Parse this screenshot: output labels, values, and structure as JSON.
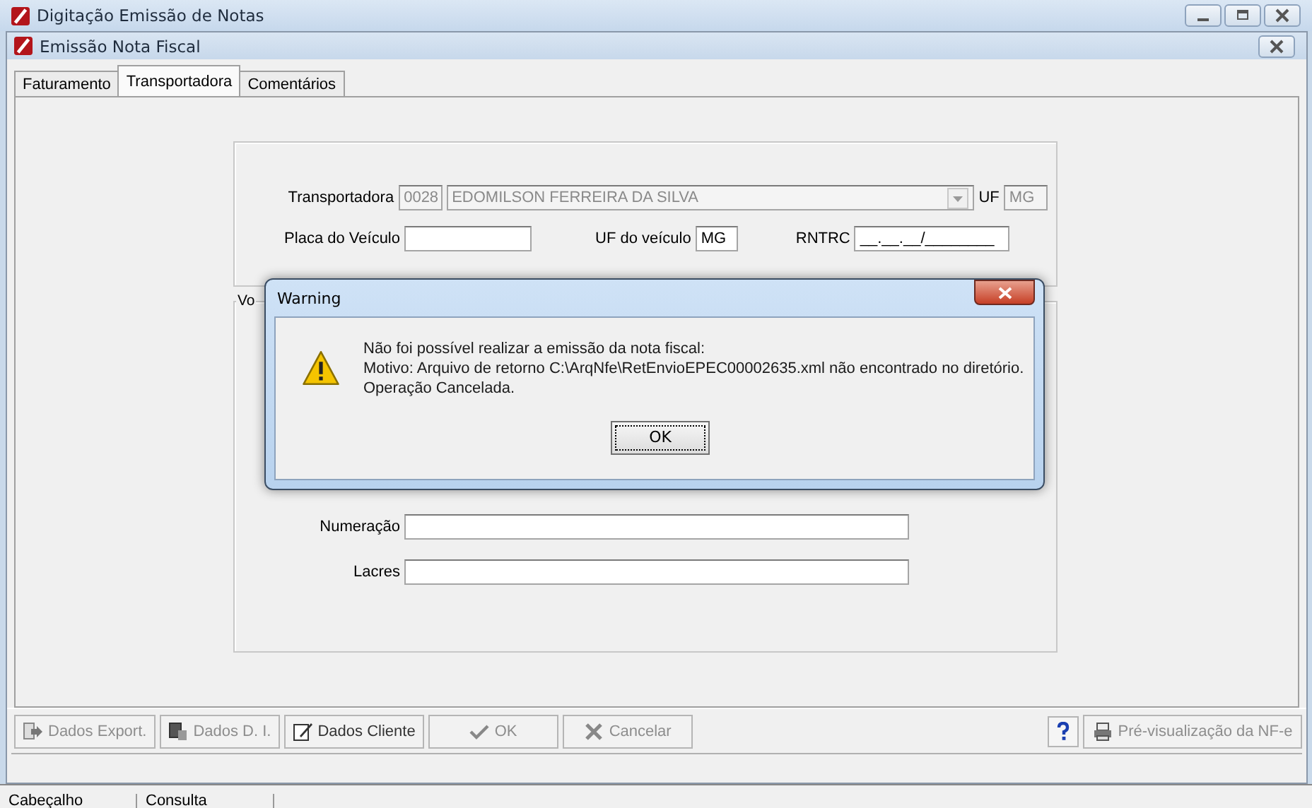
{
  "outer_window": {
    "title": "Digitação Emissão de Notas"
  },
  "inner_window": {
    "title": "Emissão Nota Fiscal"
  },
  "tabs": [
    {
      "label": "Faturamento",
      "selected": false
    },
    {
      "label": "Transportadora",
      "selected": true
    },
    {
      "label": "Comentários",
      "selected": false
    }
  ],
  "carrier_group": {
    "code_label": "Transportadora",
    "code": "0028",
    "name": "EDOMILSON FERREIRA DA SILVA",
    "uf_label": "UF",
    "uf": "MG",
    "disabled": true,
    "plate_label": "Placa do Veículo",
    "vehicle_uf_label": "UF do veículo",
    "vehicle_uf": "MG",
    "rntrc_label": "RNTRC",
    "rntrc": "__.__.__/________"
  },
  "volume_group": {
    "title": "Vo",
    "fields": [
      {
        "label": "Numeração"
      },
      {
        "label": "Lacres"
      }
    ]
  },
  "dialog": {
    "title": "Warning",
    "lines": [
      "Não foi possível realizar a emissão da nota fiscal:",
      "Motivo: Arquivo de retorno C:\\ArqNfe\\RetEnvioEPEC00002635.xml não encontrado no diretório.",
      "Operação Cancelada."
    ],
    "button": "OK"
  },
  "buttons": [
    {
      "kind": "export",
      "label": "Dados Export.",
      "disabled": true
    },
    {
      "kind": "import",
      "label": "Dados D. I.",
      "disabled": true
    },
    {
      "kind": "client",
      "label": "Dados Cliente",
      "disabled": false
    },
    {
      "kind": "ok",
      "label": "OK",
      "disabled": true
    },
    {
      "kind": "cancel",
      "label": "Cancelar",
      "disabled": true
    }
  ],
  "preview_button": {
    "label": "Pré-visualização da NF-e",
    "disabled": true
  },
  "bottom_tabs": [
    "Cabeçalho",
    "Consulta"
  ]
}
